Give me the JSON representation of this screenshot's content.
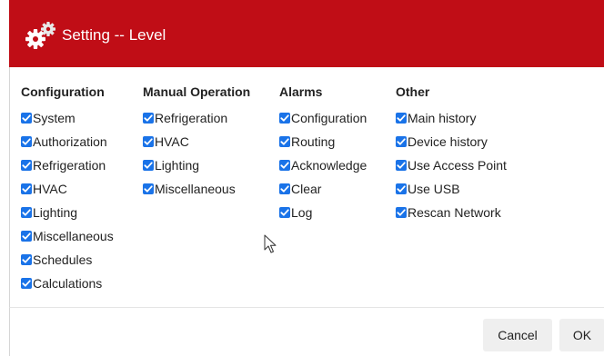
{
  "dialog": {
    "title": "Setting -- Level",
    "title_icon": "gears-icon",
    "accent_color": "#c00d16",
    "checkbox_color": "#1a73e8"
  },
  "columns": [
    {
      "heading": "Configuration",
      "items": [
        {
          "label": "System",
          "checked": true
        },
        {
          "label": "Authorization",
          "checked": true
        },
        {
          "label": "Refrigeration",
          "checked": true
        },
        {
          "label": "HVAC",
          "checked": true
        },
        {
          "label": "Lighting",
          "checked": true
        },
        {
          "label": "Miscellaneous",
          "checked": true
        },
        {
          "label": "Schedules",
          "checked": true
        },
        {
          "label": "Calculations",
          "checked": true
        }
      ]
    },
    {
      "heading": "Manual Operation",
      "items": [
        {
          "label": "Refrigeration",
          "checked": true
        },
        {
          "label": "HVAC",
          "checked": true
        },
        {
          "label": "Lighting",
          "checked": true
        },
        {
          "label": "Miscellaneous",
          "checked": true
        }
      ]
    },
    {
      "heading": "Alarms",
      "items": [
        {
          "label": "Configuration",
          "checked": true
        },
        {
          "label": "Routing",
          "checked": true
        },
        {
          "label": "Acknowledge",
          "checked": true
        },
        {
          "label": "Clear",
          "checked": true
        },
        {
          "label": "Log",
          "checked": true
        }
      ]
    },
    {
      "heading": "Other",
      "items": [
        {
          "label": "Main history",
          "checked": true
        },
        {
          "label": "Device history",
          "checked": true
        },
        {
          "label": "Use Access Point",
          "checked": true
        },
        {
          "label": "Use USB",
          "checked": true
        },
        {
          "label": "Rescan Network",
          "checked": true
        }
      ]
    }
  ],
  "footer": {
    "cancel_label": "Cancel",
    "ok_label": "OK"
  }
}
